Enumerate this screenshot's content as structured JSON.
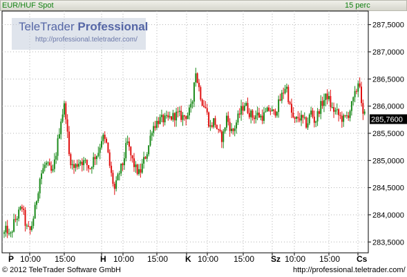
{
  "header": {
    "title": "EUR/HUF Spot",
    "interval": "15 perc"
  },
  "logo": {
    "brand_light": "TeleTrader ",
    "brand_bold": "Professional",
    "url": "http://professional.teletrader.com/"
  },
  "footer": {
    "copyright": "© 2012 TeleTrader Software GmbH",
    "url": "http://professional.teletrader.com/"
  },
  "colors": {
    "up": "#1a8a1a",
    "down": "#e01010",
    "grid": "#b0b0b0",
    "last_box": "#000000"
  },
  "chart_data": {
    "type": "candlestick",
    "title": "EUR/HUF Spot",
    "interval": "15 perc",
    "ylim": [
      283.3,
      287.75
    ],
    "yticks": [
      283.5,
      284.0,
      284.5,
      285.0,
      285.5,
      286.0,
      286.5,
      287.0,
      287.5
    ],
    "ytick_labels": [
      "283,5000",
      "284,0000",
      "284,5000",
      "285,0000",
      "285,5000",
      "286,0000",
      "286,5000",
      "287,0000",
      "287,5000"
    ],
    "last_value": 285.76,
    "last_value_label": "285,7600",
    "x_labels": [
      {
        "text": "P",
        "bold": true
      },
      {
        "text": "10:00",
        "bold": false
      },
      {
        "text": "15:00",
        "bold": false
      },
      {
        "text": "H",
        "bold": true
      },
      {
        "text": "10:00",
        "bold": false
      },
      {
        "text": "15:00",
        "bold": false
      },
      {
        "text": "K",
        "bold": true
      },
      {
        "text": "10:00",
        "bold": false
      },
      {
        "text": "15:00",
        "bold": false
      },
      {
        "text": "Sz",
        "bold": true
      },
      {
        "text": "10:00",
        "bold": false
      },
      {
        "text": "15:00",
        "bold": false
      },
      {
        "text": "Cs",
        "bold": true
      }
    ],
    "waypoints": [
      [
        0,
        283.65
      ],
      [
        4,
        283.75
      ],
      [
        8,
        283.55
      ],
      [
        14,
        283.85
      ],
      [
        18,
        283.95
      ],
      [
        26,
        284.15
      ],
      [
        32,
        283.75
      ],
      [
        38,
        283.7
      ],
      [
        44,
        284.05
      ],
      [
        52,
        284.7
      ],
      [
        60,
        284.95
      ],
      [
        70,
        284.75
      ],
      [
        76,
        285.2
      ],
      [
        82,
        285.75
      ],
      [
        88,
        286.05
      ],
      [
        94,
        285.1
      ],
      [
        100,
        284.85
      ],
      [
        110,
        285.0
      ],
      [
        118,
        284.95
      ],
      [
        124,
        284.85
      ],
      [
        130,
        285.05
      ],
      [
        136,
        285.15
      ],
      [
        142,
        285.45
      ],
      [
        148,
        285.3
      ],
      [
        154,
        284.8
      ],
      [
        160,
        284.45
      ],
      [
        166,
        284.75
      ],
      [
        172,
        284.95
      ],
      [
        178,
        285.35
      ],
      [
        184,
        285.05
      ],
      [
        190,
        284.85
      ],
      [
        196,
        284.75
      ],
      [
        202,
        285.0
      ],
      [
        208,
        285.2
      ],
      [
        214,
        285.6
      ],
      [
        224,
        285.75
      ],
      [
        236,
        285.75
      ],
      [
        250,
        285.85
      ],
      [
        258,
        285.8
      ],
      [
        266,
        285.85
      ],
      [
        272,
        286.0
      ],
      [
        276,
        286.7
      ],
      [
        280,
        286.45
      ],
      [
        286,
        286.1
      ],
      [
        292,
        285.95
      ],
      [
        298,
        285.6
      ],
      [
        304,
        285.75
      ],
      [
        310,
        285.5
      ],
      [
        316,
        285.4
      ],
      [
        322,
        285.8
      ],
      [
        330,
        285.5
      ],
      [
        336,
        285.7
      ],
      [
        342,
        285.9
      ],
      [
        348,
        286.05
      ],
      [
        354,
        285.9
      ],
      [
        360,
        285.8
      ],
      [
        366,
        285.85
      ],
      [
        372,
        285.8
      ],
      [
        378,
        285.85
      ],
      [
        384,
        285.95
      ],
      [
        390,
        285.85
      ],
      [
        396,
        286.0
      ],
      [
        402,
        286.2
      ],
      [
        408,
        286.4
      ],
      [
        414,
        285.95
      ],
      [
        420,
        285.7
      ],
      [
        426,
        285.8
      ],
      [
        432,
        285.75
      ],
      [
        438,
        285.65
      ],
      [
        444,
        285.9
      ],
      [
        450,
        285.7
      ],
      [
        456,
        285.95
      ],
      [
        462,
        286.1
      ],
      [
        468,
        286.2
      ],
      [
        474,
        285.95
      ],
      [
        480,
        285.9
      ],
      [
        486,
        285.8
      ],
      [
        492,
        285.75
      ],
      [
        498,
        285.85
      ],
      [
        504,
        286.05
      ],
      [
        510,
        286.3
      ],
      [
        514,
        286.55
      ],
      [
        518,
        285.8
      ],
      [
        524,
        285.85
      ],
      [
        530,
        285.76
      ]
    ]
  }
}
